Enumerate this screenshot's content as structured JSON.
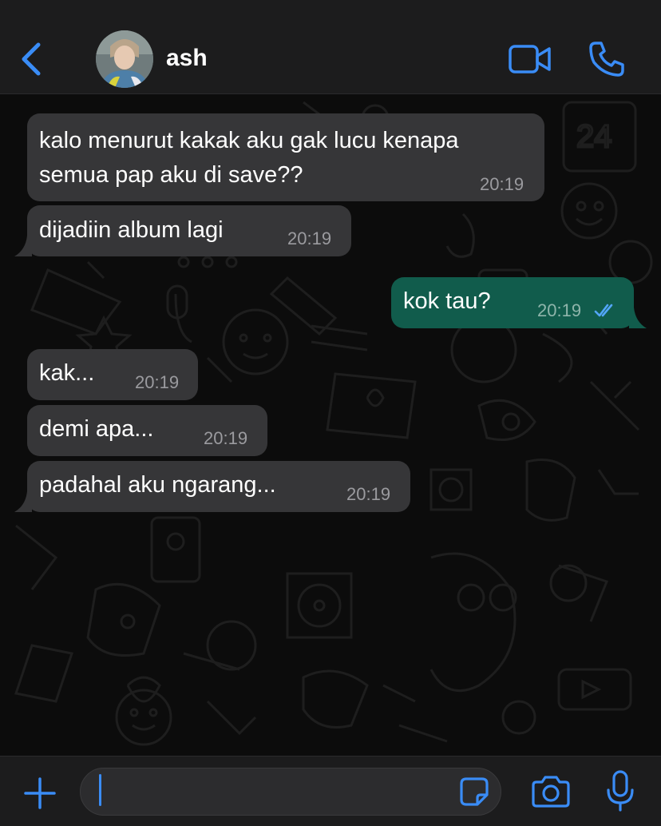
{
  "header": {
    "contact_name": "ash",
    "back_icon": "chevron-left-icon",
    "video_icon": "video-camera-icon",
    "call_icon": "phone-icon"
  },
  "messages": [
    {
      "direction": "incoming",
      "text": "kalo menurut kakak aku gak lucu kenapa\nsemua pap aku di save??",
      "time": "20:19"
    },
    {
      "direction": "incoming",
      "text": "dijadiin album lagi",
      "time": "20:19"
    },
    {
      "direction": "outgoing",
      "text": "kok tau?",
      "time": "20:19",
      "status": "read"
    },
    {
      "direction": "incoming",
      "text": "kak...",
      "time": "20:19"
    },
    {
      "direction": "incoming",
      "text": "demi apa...",
      "time": "20:19"
    },
    {
      "direction": "incoming",
      "text": "padahal aku ngarang...",
      "time": "20:19"
    }
  ],
  "composer": {
    "value": "",
    "placeholder": "",
    "plus_icon": "plus-icon",
    "sticker_icon": "sticker-icon",
    "camera_icon": "camera-icon",
    "mic_icon": "microphone-icon"
  },
  "colors": {
    "accent": "#3a8cf6",
    "incoming_bubble": "#363638",
    "outgoing_bubble": "#115c4c",
    "bar_background": "#1c1c1d",
    "chat_background": "#0c0c0c"
  }
}
